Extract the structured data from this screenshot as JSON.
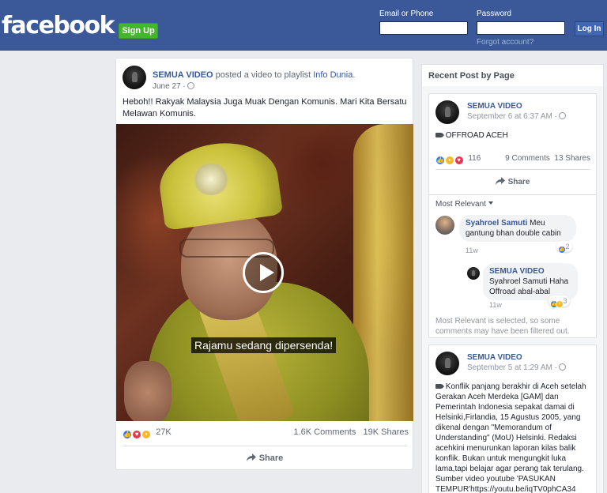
{
  "header": {
    "logo": "facebook",
    "signup_label": "Sign Up",
    "email_label": "Email or Phone",
    "password_label": "Password",
    "forgot_label": "Forgot account?",
    "login_label": "Log In",
    "bg_color": "#3b5998"
  },
  "post": {
    "author": "SEMUA VIDEO",
    "action": "posted a video to playlist",
    "playlist": "Info Dunia",
    "date": "June 27 ·",
    "text": "Heboh!! Rakyak Malaysia Juga Muak Dengan Komunis. Mari Kita Bersatu Melawan Komunis.",
    "video_caption": "Rajamu sedang dipersenda!",
    "reaction_count": "27K",
    "comments": "1.6K Comments",
    "shares": "19K Shares",
    "share_label": "Share"
  },
  "sidebar": {
    "title": "Recent Post by Page",
    "posts": [
      {
        "author": "SEMUA VIDEO",
        "date": "September 6 at 6:37 AM ·",
        "text": "OFFROAD ACEH",
        "reaction_count": "116",
        "comments": "9 Comments",
        "shares": "13 Shares",
        "share_label": "Share",
        "sort_label": "Most Relevant",
        "comments_list": [
          {
            "name": "Syahroel Samuti",
            "text": "Meu gantung bhan double cabin",
            "time": "11w",
            "reactions": "2"
          },
          {
            "name": "SEMUA VIDEO",
            "text": "Syahroel Samuti Haha Offroad abal-abal",
            "time": "11w",
            "reactions": "3"
          }
        ],
        "notice": "Most Relevant is selected, so some comments may have been filtered out."
      },
      {
        "author": "SEMUA VIDEO",
        "date": "September 5 at 1:29 AM ·",
        "text": "Konflik panjang berakhir di Aceh setelah Gerakan Aceh Merdeka [GAM] dan Pemerintah Indonesia sepakat damai di Helsinki,Firlandia, 15 Agustus 2005, yang dikenal dengan \"Memorandum of Understanding\" (MoU) Helsinki. Redaksi acehkini menurunkan laporan kilas balik konflik. Bukan untuk mengungkit luka lama,tapi belajar agar perang tak terulang. Sumber video youtube 'PASUKAN TEMPUR'https://youtu.be/iqTV0phCA34"
      }
    ]
  }
}
